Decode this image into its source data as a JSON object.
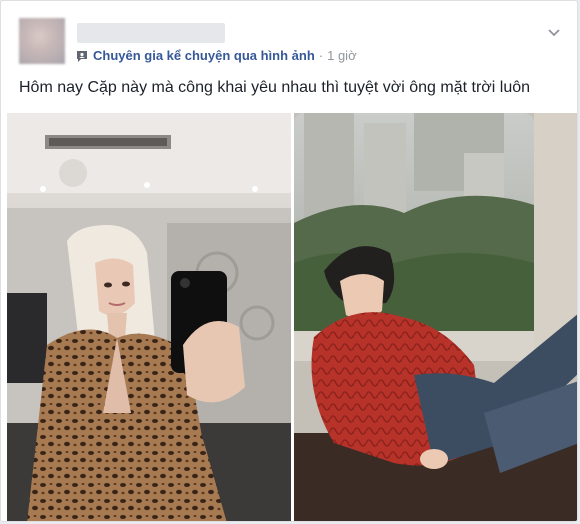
{
  "post": {
    "group_name": "Chuyên gia kể chuyện qua hình ảnh",
    "separator": "·",
    "time": "1 giờ",
    "text": "Hôm nay Cặp này mà công khai yêu nhau thì tuyệt vời ông mặt trời luôn"
  },
  "icons": {
    "group": "group-icon",
    "menu": "chevron-down-icon"
  },
  "colors": {
    "link": "#365899",
    "text": "#1d2129",
    "meta": "#90949c"
  }
}
